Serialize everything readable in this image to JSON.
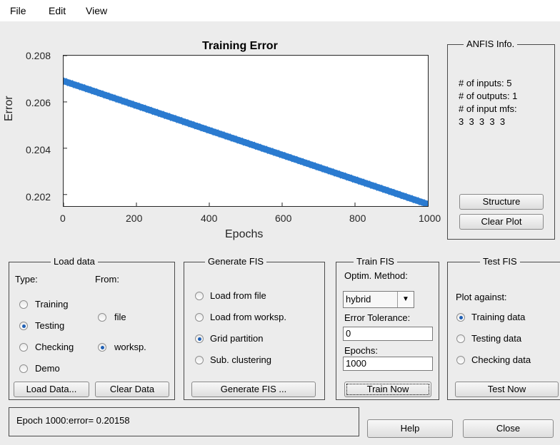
{
  "menu": {
    "items": [
      "File",
      "Edit",
      "View"
    ]
  },
  "plot": {
    "title": "Training Error",
    "xlabel": "Epochs",
    "ylabel": "Error",
    "xticks": [
      "0",
      "200",
      "400",
      "600",
      "800",
      "1000"
    ],
    "yticks": [
      "0.208",
      "0.206",
      "0.204",
      "0.202"
    ],
    "series_color": "#2b7bd0"
  },
  "chart_data": {
    "type": "line",
    "title": "Training Error",
    "xlabel": "Epochs",
    "ylabel": "Error",
    "xlim": [
      0,
      1000
    ],
    "ylim": [
      0.2015,
      0.208
    ],
    "series": [
      {
        "x": [
          1,
          1000
        ],
        "y": [
          0.2069,
          0.20158
        ]
      }
    ]
  },
  "anfis": {
    "title": "ANFIS Info.",
    "inputs": "# of inputs: 5",
    "outputs": "# of outputs: 1",
    "mfs_label": "# of input mfs:",
    "mfs_values": "3  3  3  3  3",
    "structure_button": "Structure",
    "clear_plot_button": "Clear Plot"
  },
  "load_data": {
    "title": "Load data",
    "type_label": "Type:",
    "from_label": "From:",
    "types": [
      "Training",
      "Testing",
      "Checking",
      "Demo"
    ],
    "selected_type": "Testing",
    "sources": [
      "file",
      "worksp."
    ],
    "selected_source": "worksp.",
    "load_button": "Load Data...",
    "clear_button": "Clear Data"
  },
  "generate_fis": {
    "title": "Generate FIS",
    "options": [
      "Load from file",
      "Load from worksp.",
      "Grid partition",
      "Sub. clustering"
    ],
    "selected": "Grid partition",
    "button": "Generate FIS ..."
  },
  "train_fis": {
    "title": "Train FIS",
    "method_label": "Optim. Method:",
    "method_value": "hybrid",
    "tolerance_label": "Error Tolerance:",
    "tolerance_value": "0",
    "epochs_label": "Epochs:",
    "epochs_value": "1000",
    "button": "Train Now"
  },
  "test_fis": {
    "title": "Test FIS",
    "plot_against": "Plot against:",
    "options": [
      "Training data",
      "Testing data",
      "Checking data"
    ],
    "selected": "Training data",
    "button": "Test Now"
  },
  "status": "Epoch 1000:error= 0.20158",
  "help_button": "Help",
  "close_button": "Close"
}
